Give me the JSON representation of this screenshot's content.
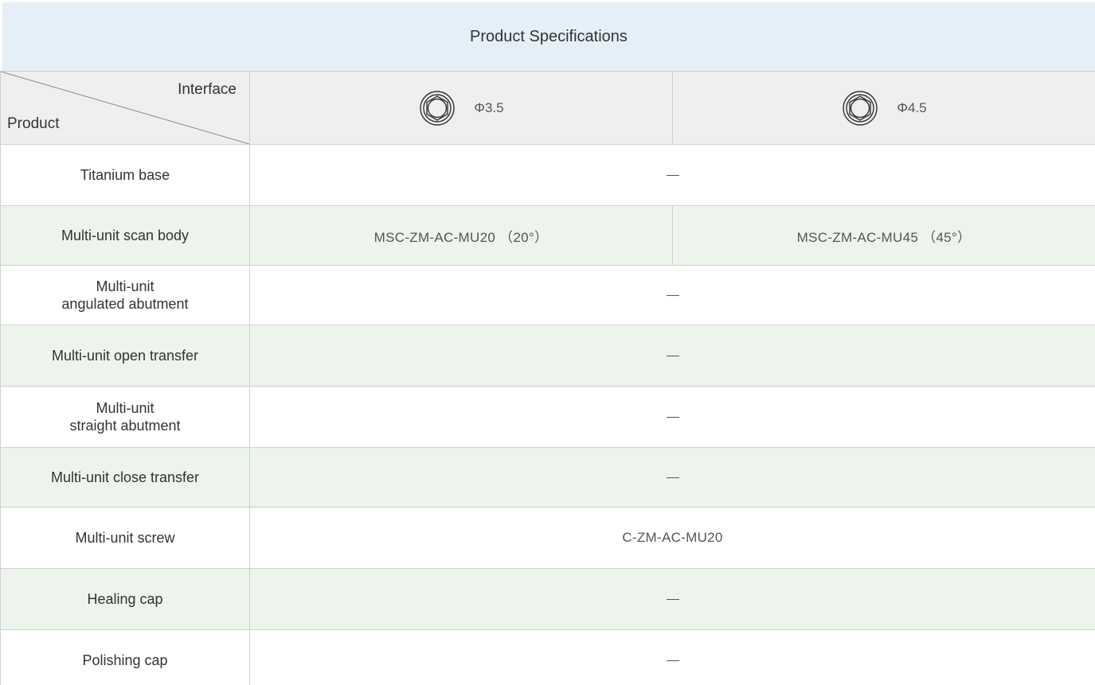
{
  "title": "Product Specifications",
  "header": {
    "corner_top": "Interface",
    "corner_bottom": "Product",
    "interfaces": [
      {
        "label": "Φ3.5",
        "icon": "hex-socket-icon"
      },
      {
        "label": "Φ4.5",
        "icon": "hex-socket-icon"
      }
    ]
  },
  "rows": [
    {
      "name_lines": [
        "Titanium base"
      ],
      "value": "—",
      "span": true
    },
    {
      "name_lines": [
        "Multi-unit scan body"
      ],
      "values": [
        "MSC-ZM-AC-MU20 （20°）",
        "MSC-ZM-AC-MU45 （45°）"
      ],
      "span": false
    },
    {
      "name_lines": [
        "Multi-unit",
        "angulated abutment"
      ],
      "value": "—",
      "span": true
    },
    {
      "name_lines": [
        "Multi-unit open transfer"
      ],
      "value": "—",
      "span": true
    },
    {
      "name_lines": [
        "Multi-unit",
        "straight abutment"
      ],
      "value": "—",
      "span": true
    },
    {
      "name_lines": [
        "Multi-unit close transfer"
      ],
      "value": "—",
      "span": true
    },
    {
      "name_lines": [
        "Multi-unit screw"
      ],
      "value": "C-ZM-AC-MU20",
      "span": true
    },
    {
      "name_lines": [
        "Healing cap"
      ],
      "value": "—",
      "span": true
    },
    {
      "name_lines": [
        "Polishing cap"
      ],
      "value": "—",
      "span": true
    }
  ],
  "colors": {
    "title_bg": "#e4eff7",
    "header_bg": "#efefef",
    "stripe_bg": "#ecf4ec",
    "border": "#cfcfcf"
  }
}
